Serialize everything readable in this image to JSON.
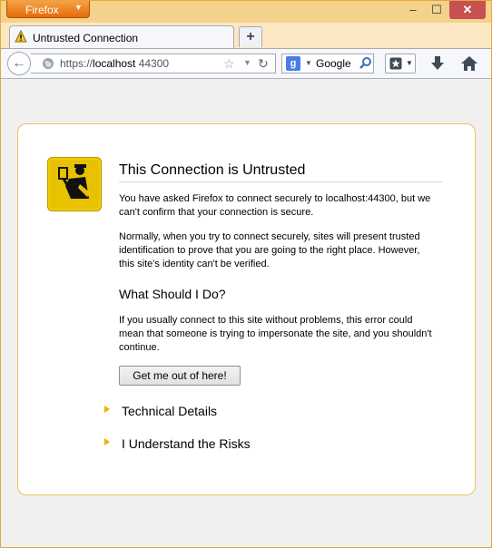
{
  "app": {
    "menu_button_label": "Firefox",
    "window_controls": {
      "minimize": "–",
      "maximize": "☐",
      "close": "✕"
    }
  },
  "tabs": [
    {
      "title": "Untrusted Connection",
      "icon": "warning-icon"
    }
  ],
  "new_tab_label": "+",
  "navbar": {
    "url_scheme": "https://",
    "url_host": "localhost",
    "url_port": " 44300",
    "search_engine_label": "Google"
  },
  "page": {
    "title": "This Connection is Untrusted",
    "para1": "You have asked Firefox to connect securely to localhost:44300, but we can't confirm that your connection is secure.",
    "para2": "Normally, when you try to connect securely, sites will present trusted identification to prove that you are going to the right place. However, this site's identity can't be verified.",
    "subtitle": "What Should I Do?",
    "para3": "If you usually connect to this site without problems, this error could mean that someone is trying to impersonate the site, and you shouldn't continue.",
    "get_out_button": "Get me out of here!",
    "technical_details": "Technical Details",
    "understand_risks": "I Understand the Risks"
  },
  "colors": {
    "accent_orange": "#e56a08",
    "border_yellow": "#ebc25e",
    "expander_triangle": "#f0b000"
  }
}
